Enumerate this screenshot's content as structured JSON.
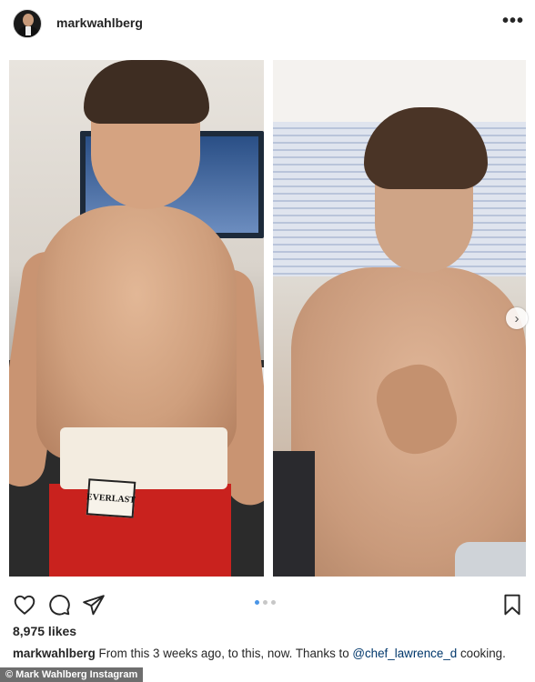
{
  "header": {
    "username": "markwahlberg",
    "more_label": "•••"
  },
  "post": {
    "carousel": {
      "next_label": "›",
      "dots_total": 3,
      "active_index": 0
    },
    "left_image": {
      "trunks_brand": "EVERLAST"
    }
  },
  "actions": {
    "like_icon": "heart-icon",
    "comment_icon": "comment-icon",
    "share_icon": "send-icon",
    "save_icon": "bookmark-icon"
  },
  "likes_text": "8,975 likes",
  "caption": {
    "username": "markwahlberg",
    "text_before": " From this 3 weeks ago, to this, now. Thanks to ",
    "mention": "@chef_lawrence_d",
    "text_after": " cooking."
  },
  "credit": "© Mark Wahlberg Instagram",
  "colors": {
    "mention": "#00376b",
    "dot_active": "#4a95e6",
    "dot_inactive": "#c7c7c7"
  }
}
